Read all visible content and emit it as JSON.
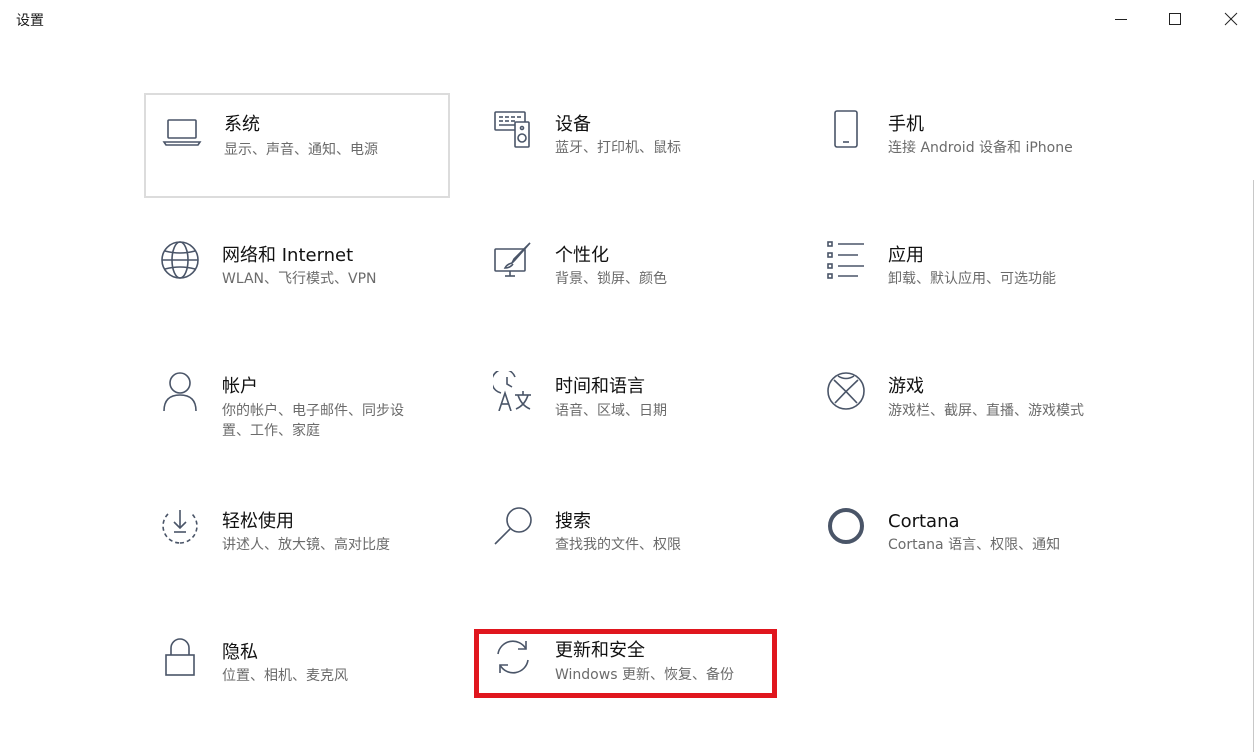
{
  "window": {
    "title": "设置",
    "minimize_icon": "minimize-icon",
    "maximize_icon": "maximize-icon",
    "close_icon": "close-icon"
  },
  "settings": {
    "system": {
      "title": "系统",
      "desc": "显示、声音、通知、电源",
      "icon": "laptop-icon"
    },
    "devices": {
      "title": "设备",
      "desc": "蓝牙、打印机、鼠标",
      "icon": "keyboard-speaker-icon"
    },
    "phone": {
      "title": "手机",
      "desc": "连接 Android 设备和 iPhone",
      "icon": "phone-icon"
    },
    "network": {
      "title": "网络和 Internet",
      "desc": "WLAN、飞行模式、VPN",
      "icon": "globe-icon"
    },
    "personalization": {
      "title": "个性化",
      "desc": "背景、锁屏、颜色",
      "icon": "paint-monitor-icon"
    },
    "apps": {
      "title": "应用",
      "desc": "卸载、默认应用、可选功能",
      "icon": "app-list-icon"
    },
    "accounts": {
      "title": "帐户",
      "desc": "你的帐户、电子邮件、同步设置、工作、家庭",
      "icon": "person-icon"
    },
    "time_language": {
      "title": "时间和语言",
      "desc": "语音、区域、日期",
      "icon": "time-language-icon"
    },
    "gaming": {
      "title": "游戏",
      "desc": "游戏栏、截屏、直播、游戏模式",
      "icon": "xbox-icon"
    },
    "ease_of_access": {
      "title": "轻松使用",
      "desc": "讲述人、放大镜、高对比度",
      "icon": "ease-of-access-icon"
    },
    "search": {
      "title": "搜索",
      "desc": "查找我的文件、权限",
      "icon": "search-icon"
    },
    "cortana": {
      "title": "Cortana",
      "desc": "Cortana 语言、权限、通知",
      "icon": "cortana-icon"
    },
    "privacy": {
      "title": "隐私",
      "desc": "位置、相机、麦克风",
      "icon": "lock-icon"
    },
    "update_security": {
      "title": "更新和安全",
      "desc": "Windows 更新、恢复、备份",
      "icon": "sync-icon"
    }
  },
  "colors": {
    "highlight": "#e0161e",
    "icon": "#4a5568",
    "desc": "#6b6b6b"
  }
}
